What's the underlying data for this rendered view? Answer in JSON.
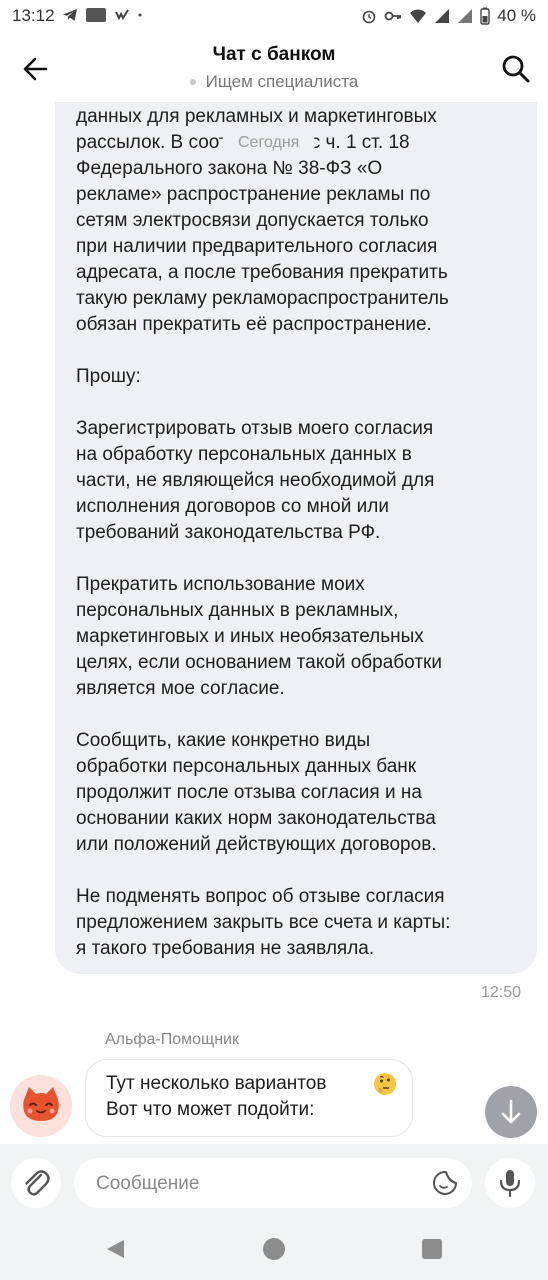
{
  "status_bar": {
    "time": "13:12",
    "battery": "40 %",
    "icons_left": [
      "telegram-icon",
      "app-badge-icon",
      "vk-icon",
      "dot-icon"
    ],
    "icons_right": [
      "alarm-icon",
      "key-icon",
      "wifi-icon",
      "signal-icon",
      "signal-icon",
      "battery-icon"
    ]
  },
  "header": {
    "title": "Чат с банком",
    "subtitle": "Ищем специалиста",
    "back_icon": "arrow-left-icon",
    "search_icon": "search-icon"
  },
  "chat": {
    "date_label": "Сегодня",
    "outgoing_message": {
      "text": "данных для рекламных и маркетинговых\nрассылок. В соответствии с ч. 1 ст. 18\nФедерального закона № 38-ФЗ «О\nрекламе» распространение рекламы по\nсетям электросвязи допускается только\nпри наличии предварительного согласия\nадресата, а после требования прекратить\nтакую рекламу рекламораспространитель\nобязан прекратить её распространение.\n\nПрошу:\n\nЗарегистрировать отзыв моего согласия\nна обработку персональных данных в\nчасти, не являющейся необходимой для\nисполнения договоров со мной или\nтребований законодательства РФ.\n\nПрекратить использование моих\nперсональных данных в рекламных,\nмаркетинговых и иных необязательных\nцелях, если основанием такой обработки\nявляется мое согласие.\n\nСообщить, какие конкретно виды\nобработки персональных данных банк\nпродолжит после отзыва согласия и на\nосновании каких норм законодательства\nили положений действующих договоров.\n\nНе подменять вопрос об отзыве согласия\nпредложением закрыть все счета и карты:\nя такого требования не заявляла.",
      "time": "12:50"
    },
    "incoming_message": {
      "sender": "Альфа-Помощник",
      "text": "Тут несколько вариантов\nВот что может подойти:",
      "emoji": "thinking-face-icon",
      "avatar": "cat-avatar-icon"
    },
    "scroll_down_icon": "arrow-down-icon"
  },
  "composer": {
    "placeholder": "Сообщение",
    "attach_icon": "paperclip-icon",
    "sticker_icon": "sticker-icon",
    "mic_icon": "microphone-icon"
  },
  "colors": {
    "bubble_out": "#eff0f3",
    "composer_bg": "#f2f3f5",
    "scroll_button": "#9fa3a9"
  }
}
